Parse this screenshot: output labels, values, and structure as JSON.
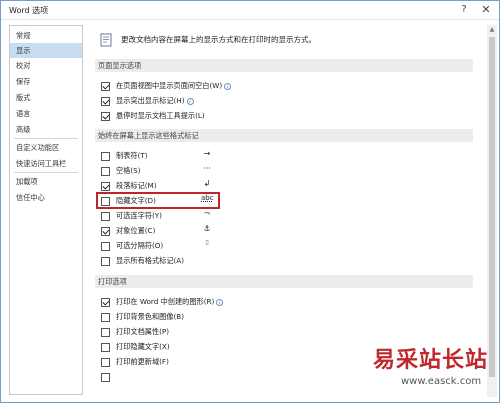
{
  "window": {
    "title": "Word 选项"
  },
  "titlebar": {
    "help_glyph": "?",
    "close_glyph": "✕"
  },
  "sidebar": {
    "items": [
      {
        "label": "常规"
      },
      {
        "label": "显示"
      },
      {
        "label": "校对"
      },
      {
        "label": "保存"
      },
      {
        "label": "版式"
      },
      {
        "label": "语言"
      },
      {
        "label": "高级"
      },
      {
        "label": "自定义功能区"
      },
      {
        "label": "快速访问工具栏"
      },
      {
        "label": "加载项"
      },
      {
        "label": "信任中心"
      }
    ],
    "active_index": 1
  },
  "main": {
    "header_text": "更改文档内容在屏幕上的显示方式和在打印时的显示方式。",
    "page_display": {
      "title": "页面显示选项",
      "options": [
        {
          "label": "在页面视图中显示页面间空白(W)",
          "checked": true,
          "info": true
        },
        {
          "label": "显示突出显示标记(H)",
          "checked": true,
          "info": true
        },
        {
          "label": "悬停时显示文档工具提示(L)",
          "checked": true,
          "info": false
        }
      ]
    },
    "formatting_marks": {
      "title": "始终在屏幕上显示这些格式标记",
      "options": [
        {
          "label": "制表符(T)",
          "checked": false,
          "symbol": "→"
        },
        {
          "label": "空格(S)",
          "checked": false,
          "symbol": "···"
        },
        {
          "label": "段落标记(M)",
          "checked": true,
          "symbol": "↲"
        },
        {
          "label": "隐藏文字(D)",
          "checked": false,
          "symbol": "abc"
        },
        {
          "label": "可选连字符(Y)",
          "checked": false,
          "symbol": "¬"
        },
        {
          "label": "对象位置(C)",
          "checked": true,
          "symbol": "⚓"
        },
        {
          "label": "可选分隔符(O)",
          "checked": false,
          "symbol": "▯"
        },
        {
          "label": "显示所有格式标记(A)",
          "checked": false,
          "symbol": ""
        }
      ]
    },
    "print": {
      "title": "打印选项",
      "options": [
        {
          "label": "打印在 Word 中创建的图形(R)",
          "checked": true,
          "info": true
        },
        {
          "label": "打印背景色和图像(B)",
          "checked": false,
          "info": false
        },
        {
          "label": "打印文档属性(P)",
          "checked": false,
          "info": false
        },
        {
          "label": "打印隐藏文字(X)",
          "checked": false,
          "info": false
        },
        {
          "label": "打印前更新域(F)",
          "checked": false,
          "info": false
        }
      ]
    }
  },
  "watermark": {
    "text": "易采站长站",
    "url": "www.easck.com"
  }
}
